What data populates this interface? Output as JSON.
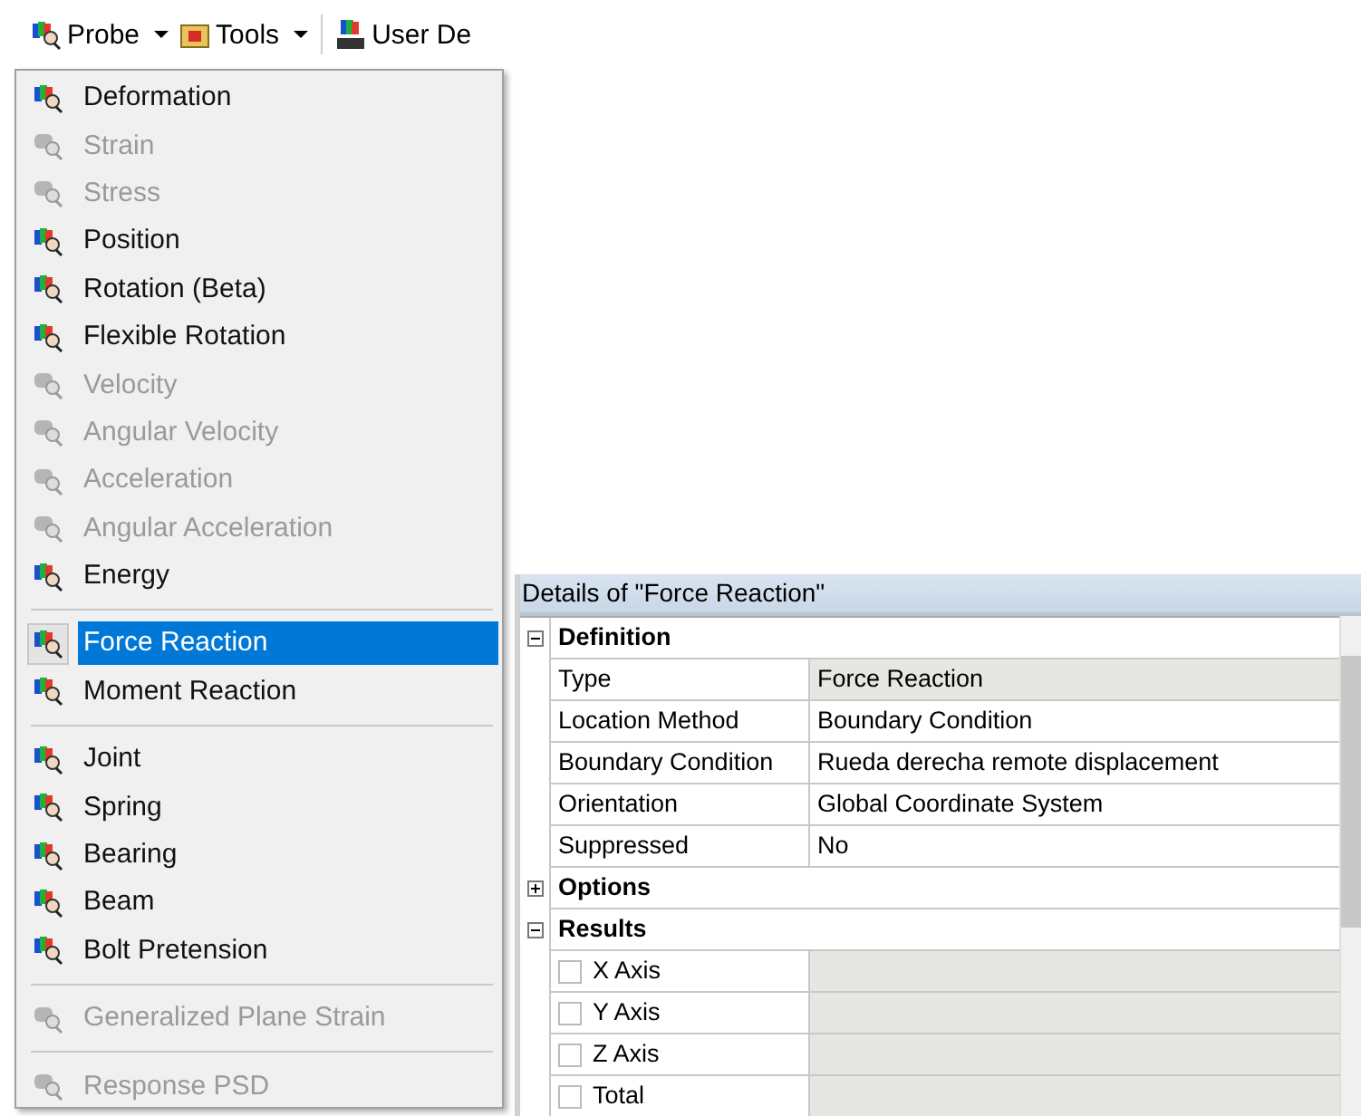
{
  "toolbar": [
    {
      "label": "Probe",
      "kind": "probe",
      "dropdown": true
    },
    {
      "label": "Tools",
      "kind": "toolbox",
      "dropdown": true
    },
    {
      "label": "User De",
      "kind": "user",
      "dropdown": false
    }
  ],
  "menu": {
    "groups": [
      [
        {
          "label": "Deformation",
          "disabled": false,
          "selected": false
        },
        {
          "label": "Strain",
          "disabled": true,
          "selected": false
        },
        {
          "label": "Stress",
          "disabled": true,
          "selected": false
        },
        {
          "label": "Position",
          "disabled": false,
          "selected": false
        },
        {
          "label": "Rotation (Beta)",
          "disabled": false,
          "selected": false
        },
        {
          "label": "Flexible Rotation",
          "disabled": false,
          "selected": false
        },
        {
          "label": "Velocity",
          "disabled": true,
          "selected": false
        },
        {
          "label": "Angular Velocity",
          "disabled": true,
          "selected": false
        },
        {
          "label": "Acceleration",
          "disabled": true,
          "selected": false
        },
        {
          "label": "Angular Acceleration",
          "disabled": true,
          "selected": false
        },
        {
          "label": "Energy",
          "disabled": false,
          "selected": false
        }
      ],
      [
        {
          "label": "Force Reaction",
          "disabled": false,
          "selected": true
        },
        {
          "label": "Moment Reaction",
          "disabled": false,
          "selected": false
        }
      ],
      [
        {
          "label": "Joint",
          "disabled": false,
          "selected": false
        },
        {
          "label": "Spring",
          "disabled": false,
          "selected": false
        },
        {
          "label": "Bearing",
          "disabled": false,
          "selected": false
        },
        {
          "label": "Beam",
          "disabled": false,
          "selected": false
        },
        {
          "label": "Bolt Pretension",
          "disabled": false,
          "selected": false
        }
      ],
      [
        {
          "label": "Generalized Plane Strain",
          "disabled": true,
          "selected": false
        }
      ],
      [
        {
          "label": "Response PSD",
          "disabled": true,
          "selected": false
        }
      ]
    ]
  },
  "details": {
    "title": "Details of \"Force Reaction\"",
    "sections": [
      {
        "label": "Definition",
        "expanded": true,
        "rows": [
          {
            "kind": "property",
            "name": "Type",
            "value": "Force Reaction",
            "readonly": true
          },
          {
            "kind": "property",
            "name": "Location Method",
            "value": "Boundary Condition",
            "readonly": false
          },
          {
            "kind": "property",
            "name": "Boundary Condition",
            "value": "Rueda derecha remote displacement",
            "readonly": false
          },
          {
            "kind": "property",
            "name": "Orientation",
            "value": "Global Coordinate System",
            "readonly": false
          },
          {
            "kind": "property",
            "name": "Suppressed",
            "value": "No",
            "readonly": false
          }
        ]
      },
      {
        "label": "Options",
        "expanded": false
      },
      {
        "label": "Results",
        "expanded": true,
        "rows": [
          {
            "kind": "checkbox",
            "name": "X Axis",
            "checked": false,
            "readonly": true
          },
          {
            "kind": "checkbox",
            "name": "Y Axis",
            "checked": false,
            "readonly": true
          },
          {
            "kind": "checkbox",
            "name": "Z Axis",
            "checked": false,
            "readonly": true
          },
          {
            "kind": "checkbox",
            "name": "Total",
            "checked": false,
            "readonly": true
          }
        ]
      }
    ]
  }
}
